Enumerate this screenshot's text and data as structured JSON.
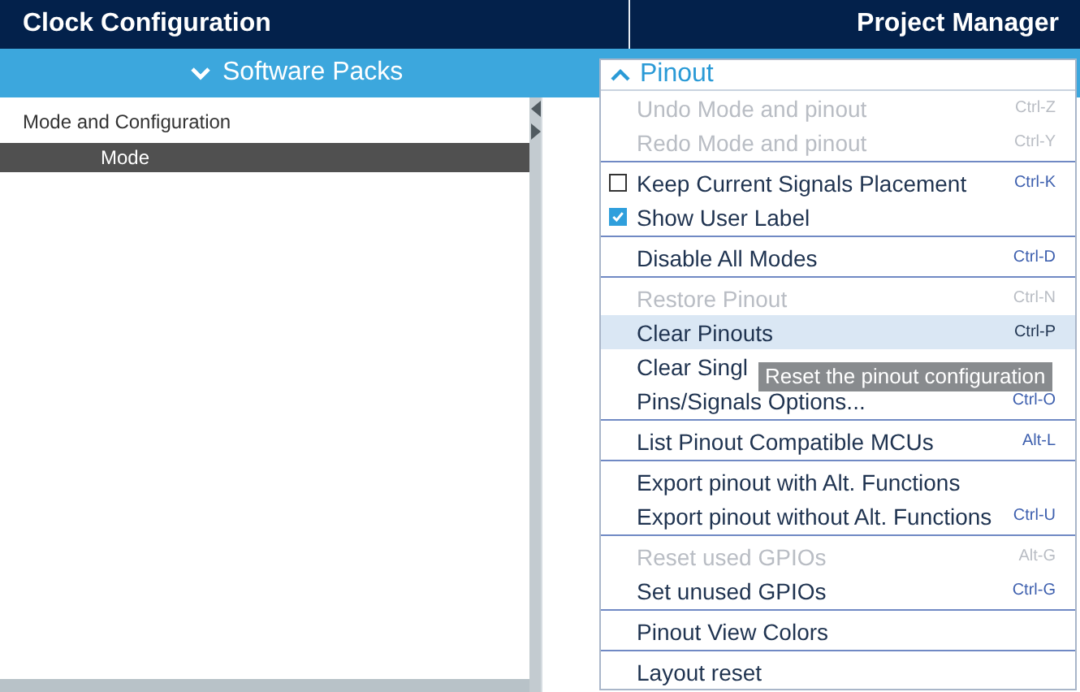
{
  "tabs": [
    {
      "label": "Clock Configuration"
    },
    {
      "label": "Project Manager"
    }
  ],
  "toolbar": {
    "software_packs": "Software Packs",
    "pinout": "Pinout",
    "pinout_expanded": true
  },
  "sidebar": {
    "title": "Mode and Configuration",
    "items": [
      {
        "label": "Mode",
        "selected": true
      }
    ]
  },
  "menu": {
    "groups": [
      [
        {
          "kind": "plain",
          "label": "Undo Mode and pinout",
          "shortcut": "Ctrl-Z",
          "disabled": true,
          "selected": false
        },
        {
          "kind": "plain",
          "label": "Redo Mode and pinout",
          "shortcut": "Ctrl-Y",
          "disabled": true,
          "selected": false
        }
      ],
      [
        {
          "kind": "check",
          "label": "Keep Current Signals Placement",
          "shortcut": "Ctrl-K",
          "checked": false,
          "disabled": false,
          "selected": false
        },
        {
          "kind": "check",
          "label": "Show User Label",
          "checked": true,
          "disabled": false,
          "selected": false
        }
      ],
      [
        {
          "kind": "plain",
          "label": "Disable All Modes",
          "shortcut": "Ctrl-D",
          "disabled": false,
          "selected": false
        }
      ],
      [
        {
          "kind": "plain",
          "label": "Restore Pinout",
          "shortcut": "Ctrl-N",
          "disabled": true,
          "selected": false
        },
        {
          "kind": "plain",
          "label": "Clear Pinouts",
          "shortcut": "Ctrl-P",
          "disabled": false,
          "selected": true
        },
        {
          "kind": "plain",
          "label": "Clear Singl",
          "disabled": false,
          "selected": false
        },
        {
          "kind": "plain",
          "label": "Pins/Signals Options...",
          "shortcut": "Ctrl-O",
          "disabled": false,
          "selected": false
        }
      ],
      [
        {
          "kind": "plain",
          "label": "List Pinout Compatible MCUs",
          "shortcut": "Alt-L",
          "disabled": false,
          "selected": false
        }
      ],
      [
        {
          "kind": "plain",
          "label": "Export pinout with Alt. Functions",
          "disabled": false,
          "selected": false
        },
        {
          "kind": "plain",
          "label": "Export pinout without Alt. Functions",
          "shortcut": "Ctrl-U",
          "disabled": false,
          "selected": false
        }
      ],
      [
        {
          "kind": "plain",
          "label": "Reset used GPIOs",
          "shortcut": "Alt-G",
          "disabled": true,
          "selected": false
        },
        {
          "kind": "plain",
          "label": "Set unused GPIOs",
          "shortcut": "Ctrl-G",
          "disabled": false,
          "selected": false
        }
      ],
      [
        {
          "kind": "plain",
          "label": "Pinout View Colors",
          "disabled": false,
          "selected": false
        }
      ],
      [
        {
          "kind": "plain",
          "label": "Layout reset",
          "disabled": false,
          "selected": false
        }
      ]
    ],
    "tooltip": "Reset the pinout configuration"
  }
}
